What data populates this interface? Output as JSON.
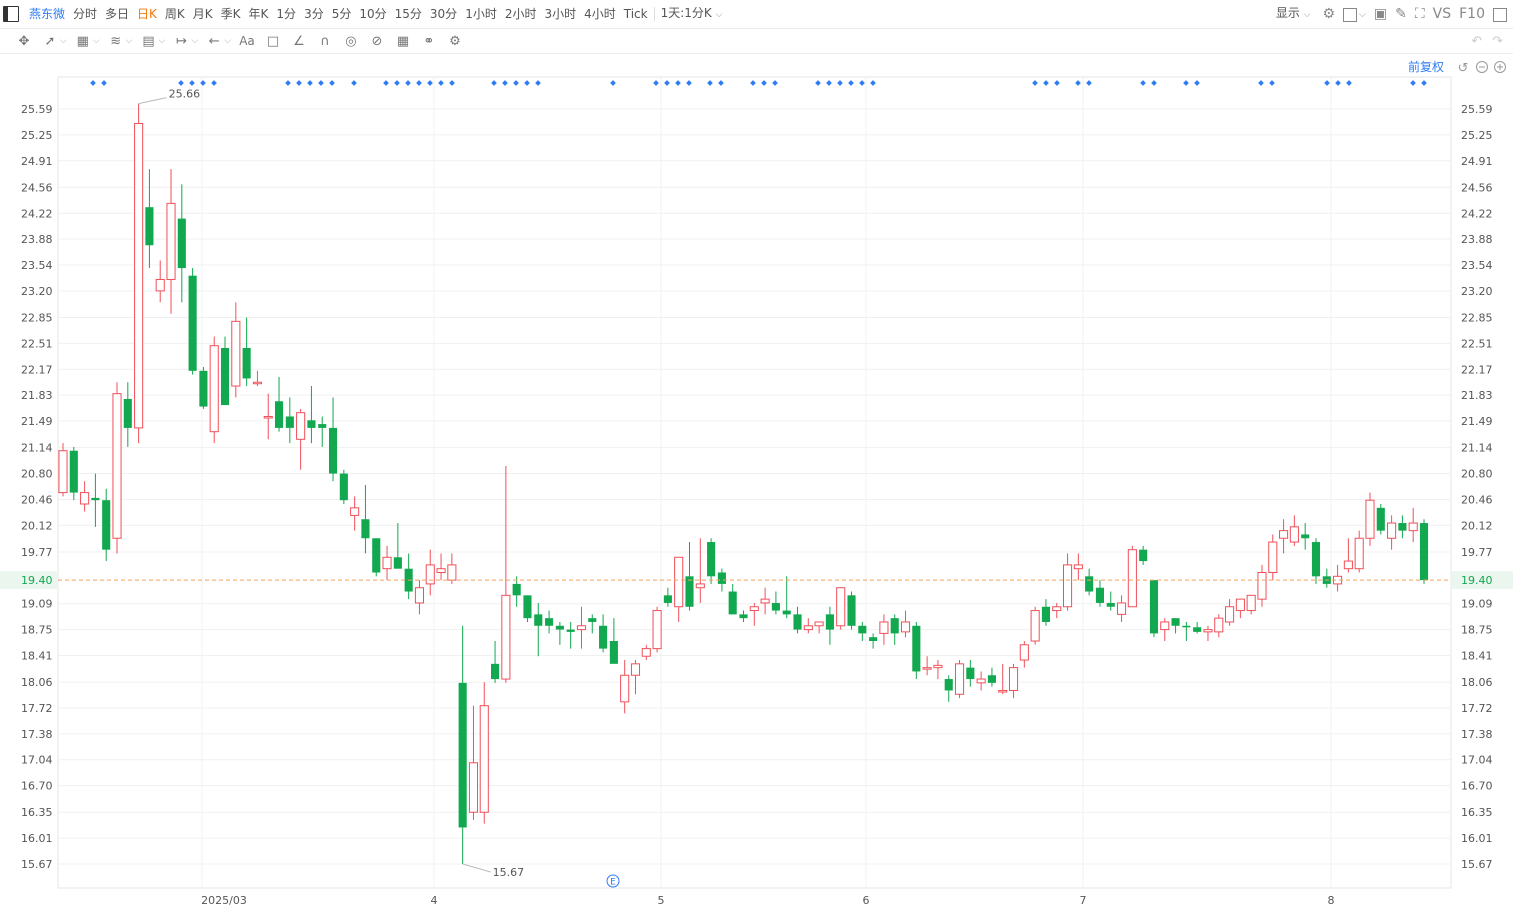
{
  "toolbar": {
    "stock_name": "燕东微",
    "periods": [
      "分时",
      "多日",
      "日K",
      "周K",
      "月K",
      "季K",
      "年K",
      "1分",
      "3分",
      "5分",
      "10分",
      "15分",
      "30分",
      "1小时",
      "2小时",
      "3小时",
      "4小时",
      "Tick"
    ],
    "active_period": "日K",
    "kline_setting": "1天:1分K",
    "display_label": "显示",
    "vs_label": "VS",
    "f10_label": "F10"
  },
  "chart_controls": {
    "adjust_label": "前复权"
  },
  "colors": {
    "up": "#f0505a",
    "down": "#11a84f",
    "current_price_line": "#f5a05a",
    "event_dot": "#2f7cf6",
    "grid": "#f0f0f0"
  },
  "chart_data": {
    "type": "candlestick",
    "x_tick_labels": [
      "2025/03",
      "4",
      "5",
      "6",
      "7",
      "8"
    ],
    "y_tick_labels": [
      "25.59",
      "25.25",
      "24.91",
      "24.56",
      "24.22",
      "23.88",
      "23.54",
      "23.20",
      "22.85",
      "22.51",
      "22.17",
      "21.83",
      "21.49",
      "21.14",
      "20.80",
      "20.46",
      "20.12",
      "19.77",
      "19.09",
      "18.75",
      "18.41",
      "18.06",
      "17.72",
      "17.38",
      "17.04",
      "16.70",
      "16.35",
      "16.01",
      "15.67"
    ],
    "current_price": "19.40",
    "max_annotation": "25.66",
    "min_annotation": "15.67",
    "event_marker": "E",
    "ylim": [
      15.4,
      26.6
    ],
    "candles": [
      {
        "o": 20.55,
        "h": 21.2,
        "l": 20.5,
        "c": 21.1
      },
      {
        "o": 21.1,
        "h": 21.15,
        "l": 20.45,
        "c": 20.55
      },
      {
        "o": 20.4,
        "h": 20.7,
        "l": 20.3,
        "c": 20.55
      },
      {
        "o": 20.48,
        "h": 20.8,
        "l": 20.1,
        "c": 20.45
      },
      {
        "o": 20.45,
        "h": 20.6,
        "l": 19.65,
        "c": 19.8
      },
      {
        "o": 19.95,
        "h": 22.0,
        "l": 19.75,
        "c": 21.85
      },
      {
        "o": 21.78,
        "h": 22.0,
        "l": 21.15,
        "c": 21.4
      },
      {
        "o": 21.4,
        "h": 25.66,
        "l": 21.2,
        "c": 25.4
      },
      {
        "o": 24.3,
        "h": 24.8,
        "l": 23.5,
        "c": 23.8
      },
      {
        "o": 23.2,
        "h": 23.6,
        "l": 23.05,
        "c": 23.35
      },
      {
        "o": 23.35,
        "h": 24.8,
        "l": 22.9,
        "c": 24.35
      },
      {
        "o": 24.15,
        "h": 24.6,
        "l": 23.05,
        "c": 23.5
      },
      {
        "o": 23.4,
        "h": 23.5,
        "l": 22.1,
        "c": 22.15
      },
      {
        "o": 22.15,
        "h": 22.2,
        "l": 21.65,
        "c": 21.68
      },
      {
        "o": 21.35,
        "h": 22.6,
        "l": 21.2,
        "c": 22.48
      },
      {
        "o": 22.45,
        "h": 22.6,
        "l": 21.7,
        "c": 21.7
      },
      {
        "o": 21.95,
        "h": 23.05,
        "l": 21.8,
        "c": 22.8
      },
      {
        "o": 22.45,
        "h": 22.85,
        "l": 21.95,
        "c": 22.05
      },
      {
        "o": 22.0,
        "h": 22.15,
        "l": 21.95,
        "c": 22.0
      },
      {
        "o": 21.55,
        "h": 21.85,
        "l": 21.25,
        "c": 21.55
      },
      {
        "o": 21.75,
        "h": 22.07,
        "l": 21.35,
        "c": 21.4
      },
      {
        "o": 21.55,
        "h": 21.8,
        "l": 21.2,
        "c": 21.4
      },
      {
        "o": 21.25,
        "h": 21.65,
        "l": 20.85,
        "c": 21.6
      },
      {
        "o": 21.5,
        "h": 21.95,
        "l": 21.2,
        "c": 21.4
      },
      {
        "o": 21.45,
        "h": 21.55,
        "l": 21.15,
        "c": 21.4
      },
      {
        "o": 21.4,
        "h": 21.8,
        "l": 20.7,
        "c": 20.8
      },
      {
        "o": 20.8,
        "h": 20.85,
        "l": 20.4,
        "c": 20.45
      },
      {
        "o": 20.25,
        "h": 20.5,
        "l": 20.05,
        "c": 20.35
      },
      {
        "o": 20.2,
        "h": 20.65,
        "l": 19.75,
        "c": 19.95
      },
      {
        "o": 19.95,
        "h": 19.95,
        "l": 19.45,
        "c": 19.5
      },
      {
        "o": 19.55,
        "h": 19.85,
        "l": 19.4,
        "c": 19.7
      },
      {
        "o": 19.7,
        "h": 20.15,
        "l": 19.6,
        "c": 19.55
      },
      {
        "o": 19.55,
        "h": 19.75,
        "l": 19.15,
        "c": 19.25
      },
      {
        "o": 19.1,
        "h": 19.4,
        "l": 18.95,
        "c": 19.3
      },
      {
        "o": 19.35,
        "h": 19.8,
        "l": 19.2,
        "c": 19.6
      },
      {
        "o": 19.5,
        "h": 19.75,
        "l": 19.4,
        "c": 19.55
      },
      {
        "o": 19.4,
        "h": 19.75,
        "l": 19.35,
        "c": 19.6
      },
      {
        "o": 18.05,
        "h": 18.8,
        "l": 15.67,
        "c": 16.15
      },
      {
        "o": 16.35,
        "h": 17.75,
        "l": 16.25,
        "c": 17.0
      },
      {
        "o": 16.35,
        "h": 18.06,
        "l": 16.2,
        "c": 17.75
      },
      {
        "o": 18.3,
        "h": 18.6,
        "l": 18.05,
        "c": 18.1
      },
      {
        "o": 18.1,
        "h": 20.9,
        "l": 18.05,
        "c": 19.2
      },
      {
        "o": 19.35,
        "h": 19.45,
        "l": 19.05,
        "c": 19.2
      },
      {
        "o": 19.2,
        "h": 19.2,
        "l": 18.85,
        "c": 18.9
      },
      {
        "o": 18.95,
        "h": 19.1,
        "l": 18.4,
        "c": 18.8
      },
      {
        "o": 18.9,
        "h": 19.0,
        "l": 18.7,
        "c": 18.8
      },
      {
        "o": 18.8,
        "h": 18.85,
        "l": 18.55,
        "c": 18.75
      },
      {
        "o": 18.75,
        "h": 18.85,
        "l": 18.5,
        "c": 18.72
      },
      {
        "o": 18.75,
        "h": 19.05,
        "l": 18.5,
        "c": 18.8
      },
      {
        "o": 18.9,
        "h": 18.95,
        "l": 18.7,
        "c": 18.85
      },
      {
        "o": 18.8,
        "h": 18.95,
        "l": 18.45,
        "c": 18.5
      },
      {
        "o": 18.6,
        "h": 18.9,
        "l": 18.35,
        "c": 18.3
      },
      {
        "o": 17.8,
        "h": 18.35,
        "l": 17.65,
        "c": 18.15
      },
      {
        "o": 18.15,
        "h": 18.35,
        "l": 17.9,
        "c": 18.3
      },
      {
        "o": 18.4,
        "h": 18.55,
        "l": 18.35,
        "c": 18.5
      },
      {
        "o": 18.5,
        "h": 19.05,
        "l": 18.45,
        "c": 19.0
      },
      {
        "o": 19.2,
        "h": 19.3,
        "l": 19.05,
        "c": 19.1
      },
      {
        "o": 19.05,
        "h": 19.65,
        "l": 18.85,
        "c": 19.7
      },
      {
        "o": 19.45,
        "h": 19.9,
        "l": 19.0,
        "c": 19.05
      },
      {
        "o": 19.3,
        "h": 19.95,
        "l": 19.1,
        "c": 19.35
      },
      {
        "o": 19.9,
        "h": 19.95,
        "l": 19.35,
        "c": 19.45
      },
      {
        "o": 19.5,
        "h": 19.55,
        "l": 19.25,
        "c": 19.35
      },
      {
        "o": 19.25,
        "h": 19.35,
        "l": 18.95,
        "c": 18.95
      },
      {
        "o": 18.95,
        "h": 19.0,
        "l": 18.85,
        "c": 18.9
      },
      {
        "o": 19.0,
        "h": 19.1,
        "l": 18.8,
        "c": 19.05
      },
      {
        "o": 19.1,
        "h": 19.3,
        "l": 18.95,
        "c": 19.15
      },
      {
        "o": 19.1,
        "h": 19.25,
        "l": 18.95,
        "c": 19.0
      },
      {
        "o": 19.0,
        "h": 19.45,
        "l": 18.9,
        "c": 18.95
      },
      {
        "o": 18.95,
        "h": 19.05,
        "l": 18.7,
        "c": 18.75
      },
      {
        "o": 18.75,
        "h": 18.9,
        "l": 18.7,
        "c": 18.8
      },
      {
        "o": 18.8,
        "h": 18.85,
        "l": 18.7,
        "c": 18.85
      },
      {
        "o": 18.95,
        "h": 19.05,
        "l": 18.55,
        "c": 18.75
      },
      {
        "o": 18.8,
        "h": 19.3,
        "l": 18.75,
        "c": 19.3
      },
      {
        "o": 19.2,
        "h": 19.25,
        "l": 18.75,
        "c": 18.8
      },
      {
        "o": 18.8,
        "h": 18.85,
        "l": 18.6,
        "c": 18.7
      },
      {
        "o": 18.65,
        "h": 18.7,
        "l": 18.5,
        "c": 18.6
      },
      {
        "o": 18.7,
        "h": 18.95,
        "l": 18.55,
        "c": 18.85
      },
      {
        "o": 18.9,
        "h": 18.95,
        "l": 18.55,
        "c": 18.7
      },
      {
        "o": 18.72,
        "h": 19.0,
        "l": 18.65,
        "c": 18.85
      },
      {
        "o": 18.8,
        "h": 18.85,
        "l": 18.1,
        "c": 18.2
      },
      {
        "o": 18.25,
        "h": 18.4,
        "l": 18.15,
        "c": 18.25
      },
      {
        "o": 18.25,
        "h": 18.35,
        "l": 18.1,
        "c": 18.28
      },
      {
        "o": 18.1,
        "h": 18.15,
        "l": 17.8,
        "c": 17.95
      },
      {
        "o": 17.9,
        "h": 18.35,
        "l": 17.85,
        "c": 18.3
      },
      {
        "o": 18.25,
        "h": 18.35,
        "l": 18.0,
        "c": 18.1
      },
      {
        "o": 18.05,
        "h": 18.2,
        "l": 17.95,
        "c": 18.1
      },
      {
        "o": 18.15,
        "h": 18.25,
        "l": 18.0,
        "c": 18.05
      },
      {
        "o": 17.95,
        "h": 18.3,
        "l": 17.9,
        "c": 17.95
      },
      {
        "o": 17.95,
        "h": 18.3,
        "l": 17.85,
        "c": 18.25
      },
      {
        "o": 18.35,
        "h": 18.6,
        "l": 18.25,
        "c": 18.55
      },
      {
        "o": 18.6,
        "h": 19.05,
        "l": 18.55,
        "c": 19.0
      },
      {
        "o": 19.05,
        "h": 19.15,
        "l": 18.8,
        "c": 18.85
      },
      {
        "o": 19.0,
        "h": 19.1,
        "l": 18.9,
        "c": 19.05
      },
      {
        "o": 19.05,
        "h": 19.75,
        "l": 19.0,
        "c": 19.6
      },
      {
        "o": 19.55,
        "h": 19.75,
        "l": 19.4,
        "c": 19.6
      },
      {
        "o": 19.45,
        "h": 19.55,
        "l": 19.2,
        "c": 19.25
      },
      {
        "o": 19.3,
        "h": 19.4,
        "l": 19.05,
        "c": 19.1
      },
      {
        "o": 19.1,
        "h": 19.25,
        "l": 19.0,
        "c": 19.05
      },
      {
        "o": 18.95,
        "h": 19.2,
        "l": 18.85,
        "c": 19.1
      },
      {
        "o": 19.05,
        "h": 19.85,
        "l": 19.05,
        "c": 19.8
      },
      {
        "o": 19.8,
        "h": 19.85,
        "l": 19.6,
        "c": 19.65
      },
      {
        "o": 19.4,
        "h": 19.4,
        "l": 18.65,
        "c": 18.7
      },
      {
        "o": 18.75,
        "h": 18.9,
        "l": 18.6,
        "c": 18.85
      },
      {
        "o": 18.9,
        "h": 18.9,
        "l": 18.7,
        "c": 18.8
      },
      {
        "o": 18.8,
        "h": 18.85,
        "l": 18.6,
        "c": 18.78
      },
      {
        "o": 18.78,
        "h": 18.85,
        "l": 18.7,
        "c": 18.72
      },
      {
        "o": 18.72,
        "h": 18.8,
        "l": 18.6,
        "c": 18.75
      },
      {
        "o": 18.72,
        "h": 18.95,
        "l": 18.65,
        "c": 18.9
      },
      {
        "o": 18.85,
        "h": 19.15,
        "l": 18.8,
        "c": 19.05
      },
      {
        "o": 19.0,
        "h": 19.15,
        "l": 18.9,
        "c": 19.15
      },
      {
        "o": 19.0,
        "h": 19.2,
        "l": 18.95,
        "c": 19.2
      },
      {
        "o": 19.15,
        "h": 19.6,
        "l": 19.05,
        "c": 19.5
      },
      {
        "o": 19.5,
        "h": 20.0,
        "l": 19.4,
        "c": 19.9
      },
      {
        "o": 19.95,
        "h": 20.2,
        "l": 19.75,
        "c": 20.05
      },
      {
        "o": 19.9,
        "h": 20.25,
        "l": 19.85,
        "c": 20.1
      },
      {
        "o": 20.0,
        "h": 20.15,
        "l": 19.8,
        "c": 19.95
      },
      {
        "o": 19.9,
        "h": 19.95,
        "l": 19.35,
        "c": 19.45
      },
      {
        "o": 19.45,
        "h": 19.55,
        "l": 19.3,
        "c": 19.35
      },
      {
        "o": 19.35,
        "h": 19.6,
        "l": 19.25,
        "c": 19.45
      },
      {
        "o": 19.55,
        "h": 19.95,
        "l": 19.5,
        "c": 19.65
      },
      {
        "o": 19.55,
        "h": 20.05,
        "l": 19.5,
        "c": 19.95
      },
      {
        "o": 19.95,
        "h": 20.55,
        "l": 19.85,
        "c": 20.45
      },
      {
        "o": 20.35,
        "h": 20.4,
        "l": 20.0,
        "c": 20.05
      },
      {
        "o": 19.95,
        "h": 20.25,
        "l": 19.8,
        "c": 20.15
      },
      {
        "o": 20.15,
        "h": 20.25,
        "l": 19.95,
        "c": 20.05
      },
      {
        "o": 20.05,
        "h": 20.35,
        "l": 19.9,
        "c": 20.15
      },
      {
        "o": 20.15,
        "h": 20.2,
        "l": 19.35,
        "c": 19.4
      }
    ]
  }
}
